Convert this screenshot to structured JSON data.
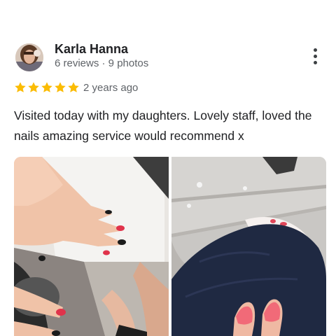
{
  "review": {
    "author": "Karla Hanna",
    "author_meta": "6 reviews · 9 photos",
    "rating": 5,
    "date": "2 years ago",
    "text": "Visited today with my daughters. Lovely staff, loved the nails amazing service would recommend x"
  },
  "icons": {
    "avatar": "avatar",
    "more": "more-vert-icon",
    "star": "star-icon"
  },
  "colors": {
    "star": "#fbbc04",
    "text": "#202124",
    "secondary_text": "#5f6368"
  }
}
